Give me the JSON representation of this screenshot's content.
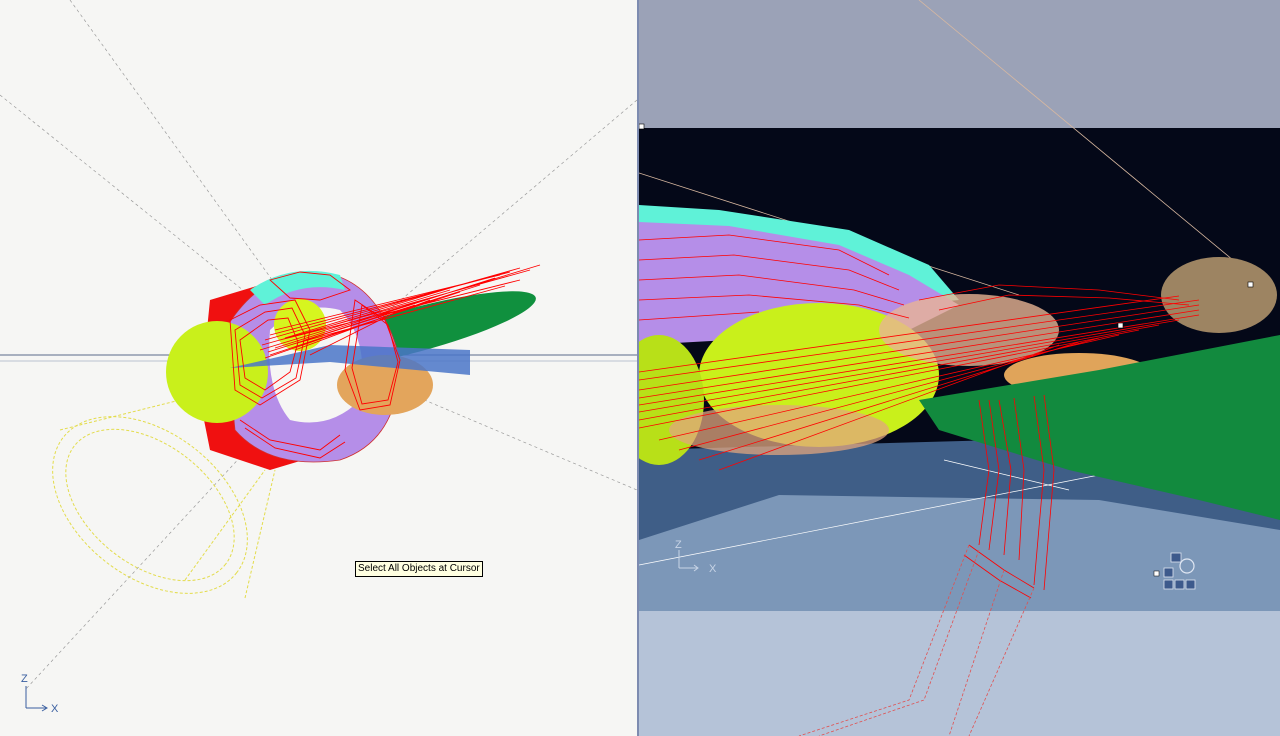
{
  "tooltip": {
    "text": "Select All Objects at Cursor"
  },
  "left_viewport": {
    "axis_z": "Z",
    "axis_x": "X"
  },
  "right_viewport": {
    "axis_z": "Z",
    "axis_x": "X"
  },
  "colors": {
    "left_bg": "#f6f6f4",
    "right_bg": "#9aa1b6",
    "scene_black": "#040818",
    "wireframe_red": "#ff0000",
    "selection_yellow": "#e8e04a",
    "torus_green": "#128a3e",
    "sphere_yellow_green": "#c9f01b",
    "sphere_tan": "#e0a45a",
    "cyan": "#5ff2d8",
    "lavender": "#b58ee8"
  },
  "icons": [
    "view-navigator-icon"
  ]
}
